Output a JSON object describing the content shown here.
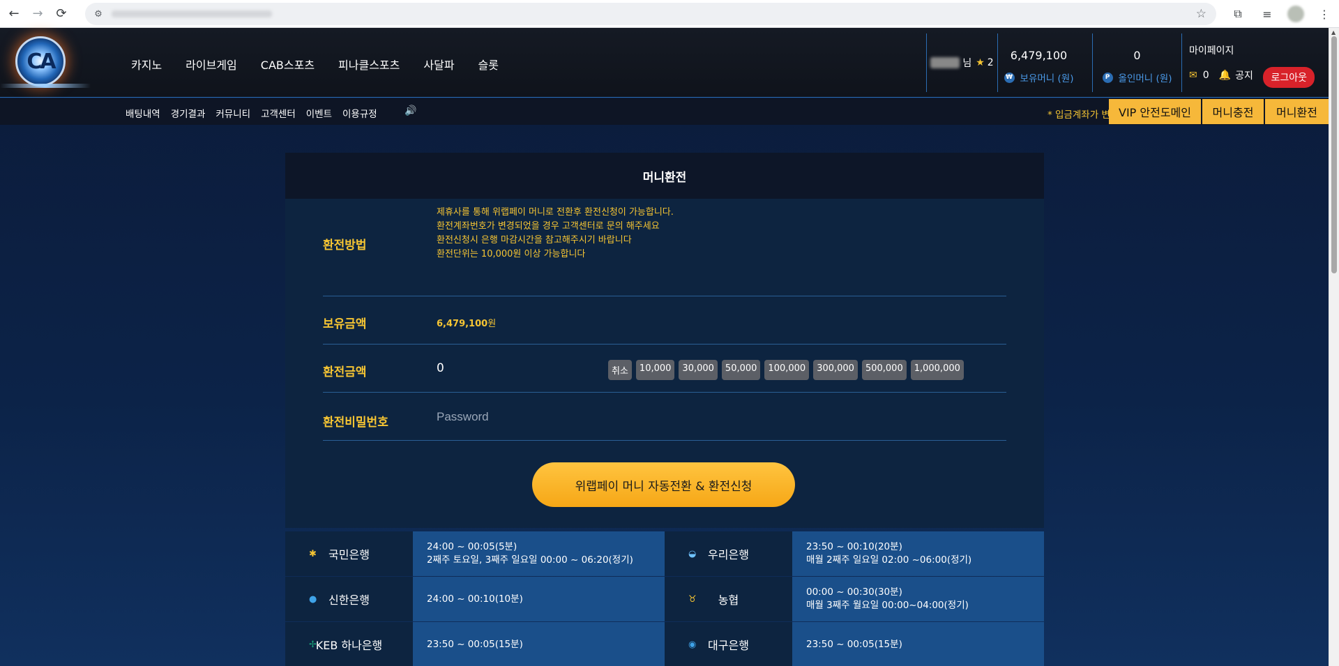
{
  "browser": {
    "back_icon": "←",
    "forward_icon": "→",
    "reload_icon": "⟳",
    "tune_icon": "⚙",
    "star_icon": "☆",
    "extensions_icon": "⧉",
    "media_icon": "≡",
    "menu_icon": "⋮"
  },
  "header": {
    "logo_text": "CA",
    "nav": [
      "카지노",
      "라이브게임",
      "CAB스포츠",
      "피나클스포츠",
      "사달파",
      "슬롯"
    ],
    "user_suffix": "님",
    "level": "2",
    "balance": "6,479,100",
    "balance_label": "보유머니 (원)",
    "balance_coin": "₩",
    "point": "0",
    "point_label": "올인머니 (원)",
    "point_coin": "P",
    "mypage": "마이페이지",
    "mail_count": "0",
    "notice": "공지",
    "logout": "로그아웃"
  },
  "subnav": {
    "links": [
      "배팅내역",
      "경기결과",
      "커뮤니티",
      "고객센터",
      "이벤트",
      "이용규정"
    ],
    "notice_text": "* 입금계좌가 변",
    "buttons": [
      "VIP 안전도메인",
      "머니충전",
      "머니환전"
    ]
  },
  "panel": {
    "title": "머니환전",
    "method_label": "환전방법",
    "info": [
      "제휴사를 통해 위랩페이 머니로 전환후 환전신청이 가능합니다.",
      "환전계좌번호가 변경되었을 경우 고객센터로 문의 해주세요",
      "환전신청시 은행 마감시간을 참고해주시기 바랍니다",
      "환전단위는 10,000원 이상 가능합니다"
    ],
    "balance_label": "보유금액",
    "balance_value": "6,479,100",
    "balance_unit": "원",
    "amount_label": "환전금액",
    "amount_value": "0",
    "chips": [
      "취소",
      "10,000",
      "30,000",
      "50,000",
      "100,000",
      "300,000",
      "500,000",
      "1,000,000"
    ],
    "password_label": "환전비밀번호",
    "password_placeholder": "Password",
    "submit": "위랩페이 머니 자동전환 & 환전신청"
  },
  "banks": [
    {
      "left": {
        "name": "국민은행",
        "icon": "✱",
        "icon_color": "#f6c533",
        "lines": [
          "24:00 ~ 00:05(5분)",
          "2째주 토요일, 3째주 일요일 00:00 ~ 06:20(정기)"
        ]
      },
      "right": {
        "name": "우리은행",
        "icon": "◒",
        "icon_color": "#6fc3ff",
        "lines": [
          "23:50 ~ 00:10(20분)",
          "매월 2째주 일요일 02:00 ~06:00(정기)"
        ]
      }
    },
    {
      "left": {
        "name": "신한은행",
        "icon": "●",
        "icon_color": "#3fa3e8",
        "lines": [
          "24:00 ~ 00:10(10분)"
        ]
      },
      "right": {
        "name": "농협",
        "icon": "♉",
        "icon_color": "#f6c533",
        "lines": [
          "00:00 ~ 00:30(30분)",
          "매월 3째주 월요일 00:00~04:00(정기)"
        ]
      }
    },
    {
      "left": {
        "name": "KEB 하나은행",
        "icon": "✢",
        "icon_color": "#1aa37a",
        "lines": [
          "23:50 ~ 00:05(15분)"
        ]
      },
      "right": {
        "name": "대구은행",
        "icon": "◉",
        "icon_color": "#3fa3e8",
        "lines": [
          "23:50 ~ 00:05(15분)"
        ]
      }
    }
  ]
}
